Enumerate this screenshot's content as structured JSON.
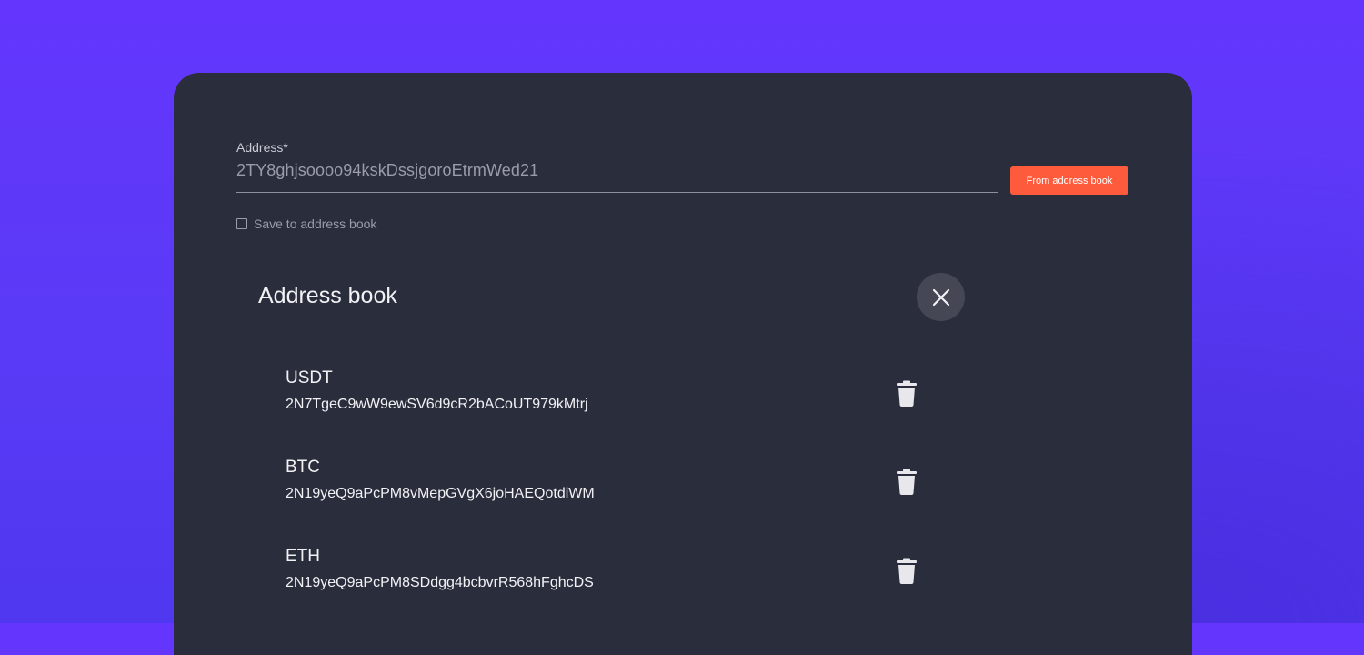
{
  "form": {
    "address_label": "Address*",
    "address_value": "2TY8ghjsoooo94kskDssjgoroEtrmWed21",
    "from_book_button": "From address book",
    "save_checkbox_label": "Save to address book",
    "save_checked": false
  },
  "address_book": {
    "title": "Address book",
    "entries": [
      {
        "name": "USDT",
        "address": "2N7TgeC9wW9ewSV6d9cR2bACoUT979kMtrj"
      },
      {
        "name": "BTC",
        "address": "2N19yeQ9aPcPM8vMepGVgX6joHAEQotdiWM"
      },
      {
        "name": "ETH",
        "address": "2N19yeQ9aPcPM8SDdgg4bcbvrR568hFghcDS"
      }
    ]
  },
  "icons": {
    "close": "close-icon",
    "delete": "trash-icon"
  },
  "colors": {
    "background": "#5f38fb",
    "panel": "#2a2d3c",
    "accent": "#fe5b3c",
    "close_button_bg": "#454755"
  }
}
